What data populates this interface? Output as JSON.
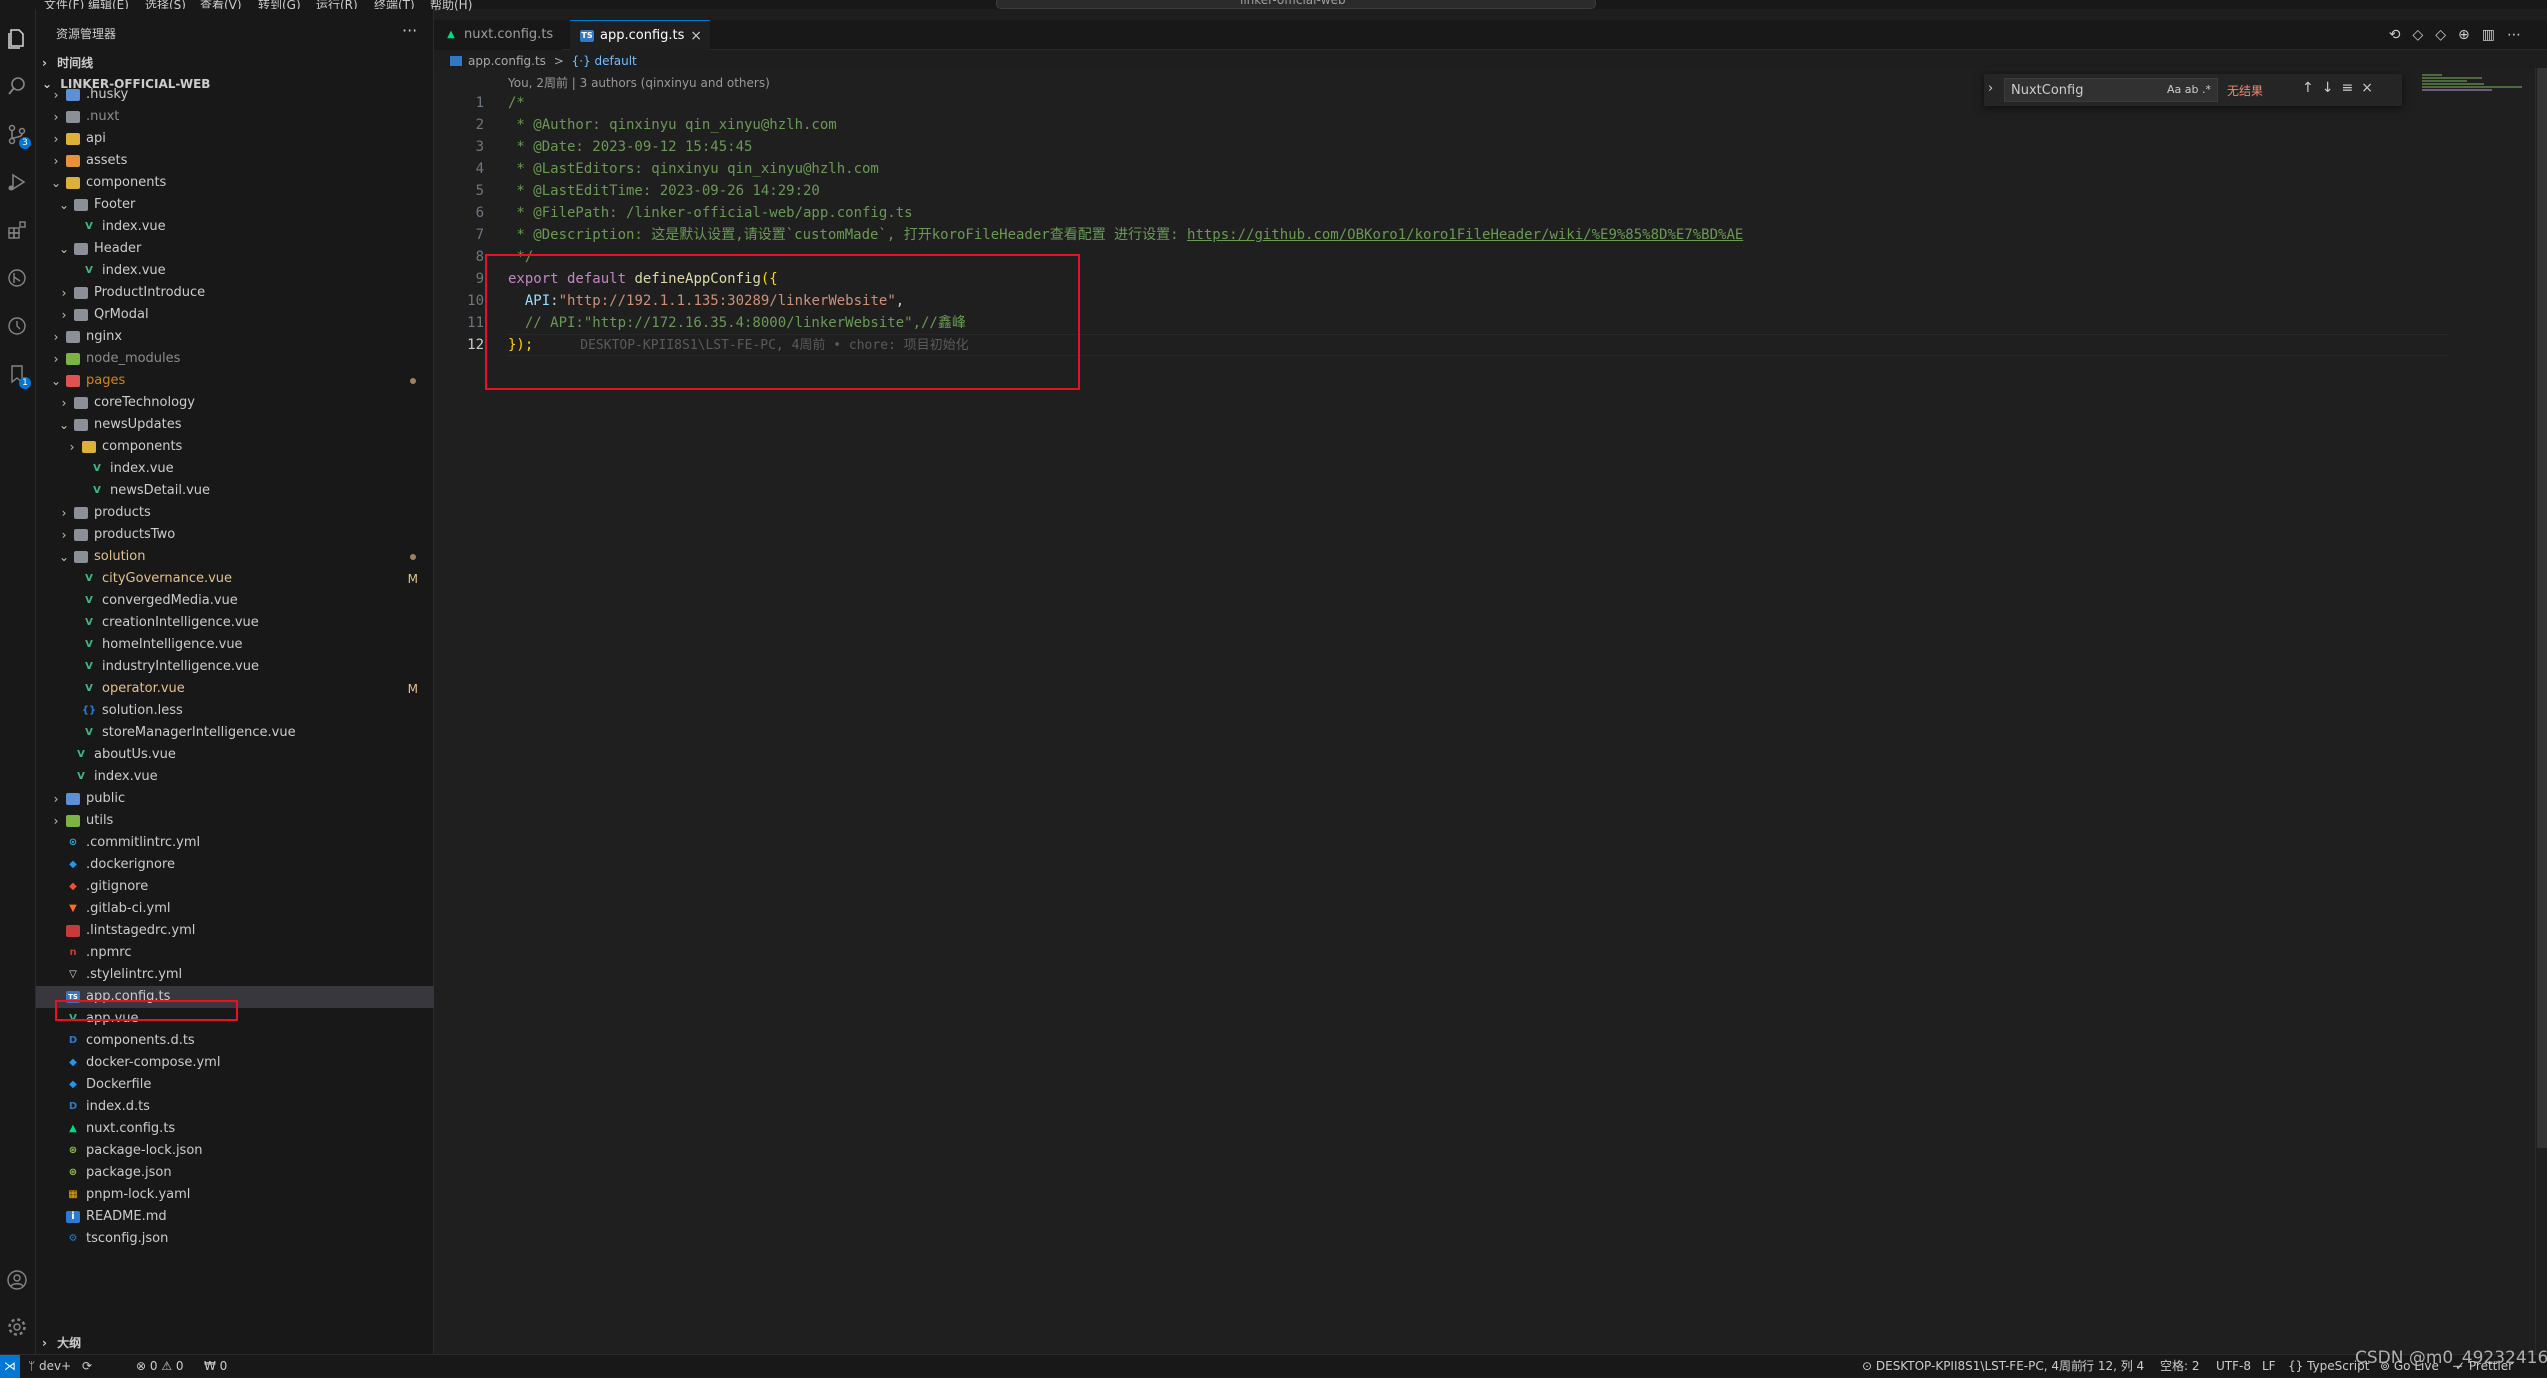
{
  "window": {
    "title": "linker-official-web",
    "menu": [
      "文件(F)",
      "编辑(E)",
      "选择(S)",
      "查看(V)",
      "转到(G)",
      "运行(R)",
      "终端(T)",
      "帮助(H)"
    ]
  },
  "activity_bar": {
    "icons": [
      "explorer-icon",
      "search-icon",
      "source-control-icon",
      "run-debug-icon",
      "extensions-icon",
      "git-graph-icon",
      "timeline-icon",
      "bookmark-icon",
      "account-icon",
      "settings-gear-icon"
    ],
    "source_control_badge": "3",
    "bookmark_badge": "1"
  },
  "sidebar": {
    "title": "资源管理器",
    "more": "···",
    "timeline_label": "时间线",
    "root_label": "LINKER-OFFICIAL-WEB",
    "outline_label": "大纲",
    "tree": [
      {
        "name": ".husky",
        "depth": 0,
        "type": "folder",
        "icon": "folder-blue",
        "open": false
      },
      {
        "name": ".nuxt",
        "depth": 0,
        "type": "folder",
        "icon": "folder-grey",
        "open": false,
        "dim": true
      },
      {
        "name": "api",
        "depth": 0,
        "type": "folder",
        "icon": "folder-yellow",
        "open": false
      },
      {
        "name": "assets",
        "depth": 0,
        "type": "folder",
        "icon": "folder-orange",
        "open": false
      },
      {
        "name": "components",
        "depth": 0,
        "type": "folder",
        "icon": "folder-yellow",
        "open": true
      },
      {
        "name": "Footer",
        "depth": 1,
        "type": "folder",
        "icon": "folder-grey",
        "open": true
      },
      {
        "name": "index.vue",
        "depth": 2,
        "type": "file",
        "icon": "vue"
      },
      {
        "name": "Header",
        "depth": 1,
        "type": "folder",
        "icon": "folder-grey",
        "open": true
      },
      {
        "name": "index.vue",
        "depth": 2,
        "type": "file",
        "icon": "vue"
      },
      {
        "name": "ProductIntroduce",
        "depth": 1,
        "type": "folder",
        "icon": "folder-grey",
        "open": false
      },
      {
        "name": "QrModal",
        "depth": 1,
        "type": "folder",
        "icon": "folder-grey",
        "open": false
      },
      {
        "name": "nginx",
        "depth": 0,
        "type": "folder",
        "icon": "folder-grey",
        "open": false
      },
      {
        "name": "node_modules",
        "depth": 0,
        "type": "folder",
        "icon": "folder-green",
        "open": false,
        "dim": true
      },
      {
        "name": "pages",
        "depth": 0,
        "type": "folder",
        "icon": "folder-red",
        "open": true,
        "accent": true,
        "dot": true
      },
      {
        "name": "coreTechnology",
        "depth": 1,
        "type": "folder",
        "icon": "folder-grey",
        "open": false
      },
      {
        "name": "newsUpdates",
        "depth": 1,
        "type": "folder",
        "icon": "folder-grey",
        "open": true
      },
      {
        "name": "components",
        "depth": 2,
        "type": "folder",
        "icon": "folder-yellow",
        "open": false
      },
      {
        "name": "index.vue",
        "depth": 3,
        "type": "file",
        "icon": "vue"
      },
      {
        "name": "newsDetail.vue",
        "depth": 3,
        "type": "file",
        "icon": "vue"
      },
      {
        "name": "products",
        "depth": 1,
        "type": "folder",
        "icon": "folder-grey",
        "open": false
      },
      {
        "name": "productsTwo",
        "depth": 1,
        "type": "folder",
        "icon": "folder-grey",
        "open": false
      },
      {
        "name": "solution",
        "depth": 1,
        "type": "folder",
        "icon": "folder-grey",
        "open": true,
        "modified": true,
        "dot": true
      },
      {
        "name": "cityGovernance.vue",
        "depth": 2,
        "type": "file",
        "icon": "vue",
        "modified": true,
        "deco": "M"
      },
      {
        "name": "convergedMedia.vue",
        "depth": 2,
        "type": "file",
        "icon": "vue"
      },
      {
        "name": "creationIntelligence.vue",
        "depth": 2,
        "type": "file",
        "icon": "vue"
      },
      {
        "name": "homeIntelligence.vue",
        "depth": 2,
        "type": "file",
        "icon": "vue"
      },
      {
        "name": "industryIntelligence.vue",
        "depth": 2,
        "type": "file",
        "icon": "vue"
      },
      {
        "name": "operator.vue",
        "depth": 2,
        "type": "file",
        "icon": "vue",
        "modified": true,
        "deco": "M"
      },
      {
        "name": "solution.less",
        "depth": 2,
        "type": "file",
        "icon": "less"
      },
      {
        "name": "storeManagerIntelligence.vue",
        "depth": 2,
        "type": "file",
        "icon": "vue"
      },
      {
        "name": "aboutUs.vue",
        "depth": 1,
        "type": "file",
        "icon": "vue"
      },
      {
        "name": "index.vue",
        "depth": 1,
        "type": "file",
        "icon": "vue"
      },
      {
        "name": "public",
        "depth": 0,
        "type": "folder",
        "icon": "folder-blue",
        "open": false
      },
      {
        "name": "utils",
        "depth": 0,
        "type": "folder",
        "icon": "folder-green",
        "open": false
      },
      {
        "name": ".commitlintrc.yml",
        "depth": 0,
        "type": "file",
        "icon": "commitlint"
      },
      {
        "name": ".dockerignore",
        "depth": 0,
        "type": "file",
        "icon": "docker"
      },
      {
        "name": ".gitignore",
        "depth": 0,
        "type": "file",
        "icon": "git"
      },
      {
        "name": ".gitlab-ci.yml",
        "depth": 0,
        "type": "file",
        "icon": "gitlab"
      },
      {
        "name": ".lintstagedrc.yml",
        "depth": 0,
        "type": "file",
        "icon": "lintstaged"
      },
      {
        "name": ".npmrc",
        "depth": 0,
        "type": "file",
        "icon": "npm"
      },
      {
        "name": ".stylelintrc.yml",
        "depth": 0,
        "type": "file",
        "icon": "stylelint"
      },
      {
        "name": "app.config.ts",
        "depth": 0,
        "type": "file",
        "icon": "ts",
        "selected": true
      },
      {
        "name": "app.vue",
        "depth": 0,
        "type": "file",
        "icon": "vue"
      },
      {
        "name": "components.d.ts",
        "depth": 0,
        "type": "file",
        "icon": "dts"
      },
      {
        "name": "docker-compose.yml",
        "depth": 0,
        "type": "file",
        "icon": "docker"
      },
      {
        "name": "Dockerfile",
        "depth": 0,
        "type": "file",
        "icon": "docker"
      },
      {
        "name": "index.d.ts",
        "depth": 0,
        "type": "file",
        "icon": "dts"
      },
      {
        "name": "nuxt.config.ts",
        "depth": 0,
        "type": "file",
        "icon": "nuxt"
      },
      {
        "name": "package-lock.json",
        "depth": 0,
        "type": "file",
        "icon": "npm-lock"
      },
      {
        "name": "package.json",
        "depth": 0,
        "type": "file",
        "icon": "npm-lock"
      },
      {
        "name": "pnpm-lock.yaml",
        "depth": 0,
        "type": "file",
        "icon": "pnpm"
      },
      {
        "name": "README.md",
        "depth": 0,
        "type": "file",
        "icon": "info"
      },
      {
        "name": "tsconfig.json",
        "depth": 0,
        "type": "file",
        "icon": "tsconfig"
      }
    ]
  },
  "tabs": [
    {
      "label": "nuxt.config.ts",
      "icon": "nuxt",
      "active": false
    },
    {
      "label": "app.config.ts",
      "icon": "ts",
      "active": true,
      "close": "×"
    }
  ],
  "breadcrumb": {
    "file": "app.config.ts",
    "separator": ">",
    "symbol": "{⋅} default"
  },
  "editor": {
    "codelens": "You, 2周前 | 3 authors (qinxinyu and others)",
    "line_numbers": [
      "1",
      "2",
      "3",
      "4",
      "5",
      "6",
      "7",
      "8",
      "9",
      "10",
      "11",
      "12"
    ],
    "current_line": "12",
    "comment": {
      "open": "/*",
      "author": " * @Author: qinxinyu qin_xinyu@hzlh.com",
      "date": " * @Date: 2023-09-12 15:45:45",
      "last_editors": " * @LastEditors: qinxinyu qin_xinyu@hzlh.com",
      "last_edit_time": " * @LastEditTime: 2023-09-26 14:29:20",
      "file_path": " * @FilePath: /linker-official-web/app.config.ts",
      "description_prefix": " * @Description: 这是默认设置,请设置`customMade`, 打开koroFileHeader查看配置 进行设置: ",
      "description_url": "https://github.com/OBKoro1/koro1FileHeader/wiki/%E9%85%8D%E7%BD%AE",
      "close": " */"
    },
    "export_kw": "export",
    "default_kw": " default ",
    "define_fn": "defineAppConfig",
    "open_paren": "({",
    "api_indent": "  ",
    "api_key": "API",
    "api_colon": ":",
    "api_value": "\"http://192.1.1.135:30289/linkerWebsite\"",
    "api_comma": ",",
    "commented_api": "  // API:\"http://172.16.35.4:8000/linkerWebsite\",//鑫峰",
    "close_paren": "});",
    "blame": "      DESKTOP-KPII8S1\\LST-FE-PC, 4周前 • chore: 项目初始化"
  },
  "find_widget": {
    "chevron": "›",
    "query": "NuxtConfig",
    "options": "Aa  ab  .*",
    "result": "无结果",
    "buttons": "↑↓≡×"
  },
  "status_bar": {
    "remote_icon": "⋊",
    "branch": "ᛘ dev+",
    "sync": "⟳",
    "problems": "⊗ 0 ⚠ 0",
    "ports": "₩ 0",
    "blame": "⊙ DESKTOP-KPII8S1\\LST-FE-PC, 4周前",
    "position": "行 12, 列 4",
    "spaces": "空格: 2",
    "encoding": "UTF-8",
    "eol": "LF",
    "language": "{} TypeScript",
    "golive": "⊚ Go Live",
    "prettier": "✓ Prettier"
  },
  "watermark": "CSDN @m0_49232416",
  "colors": {
    "accent": "#0078d4",
    "highlight_box": "#e81123",
    "comment": "#6a9955",
    "keyword": "#c586c0",
    "string": "#ce9178",
    "modified": "#e2c08d"
  }
}
